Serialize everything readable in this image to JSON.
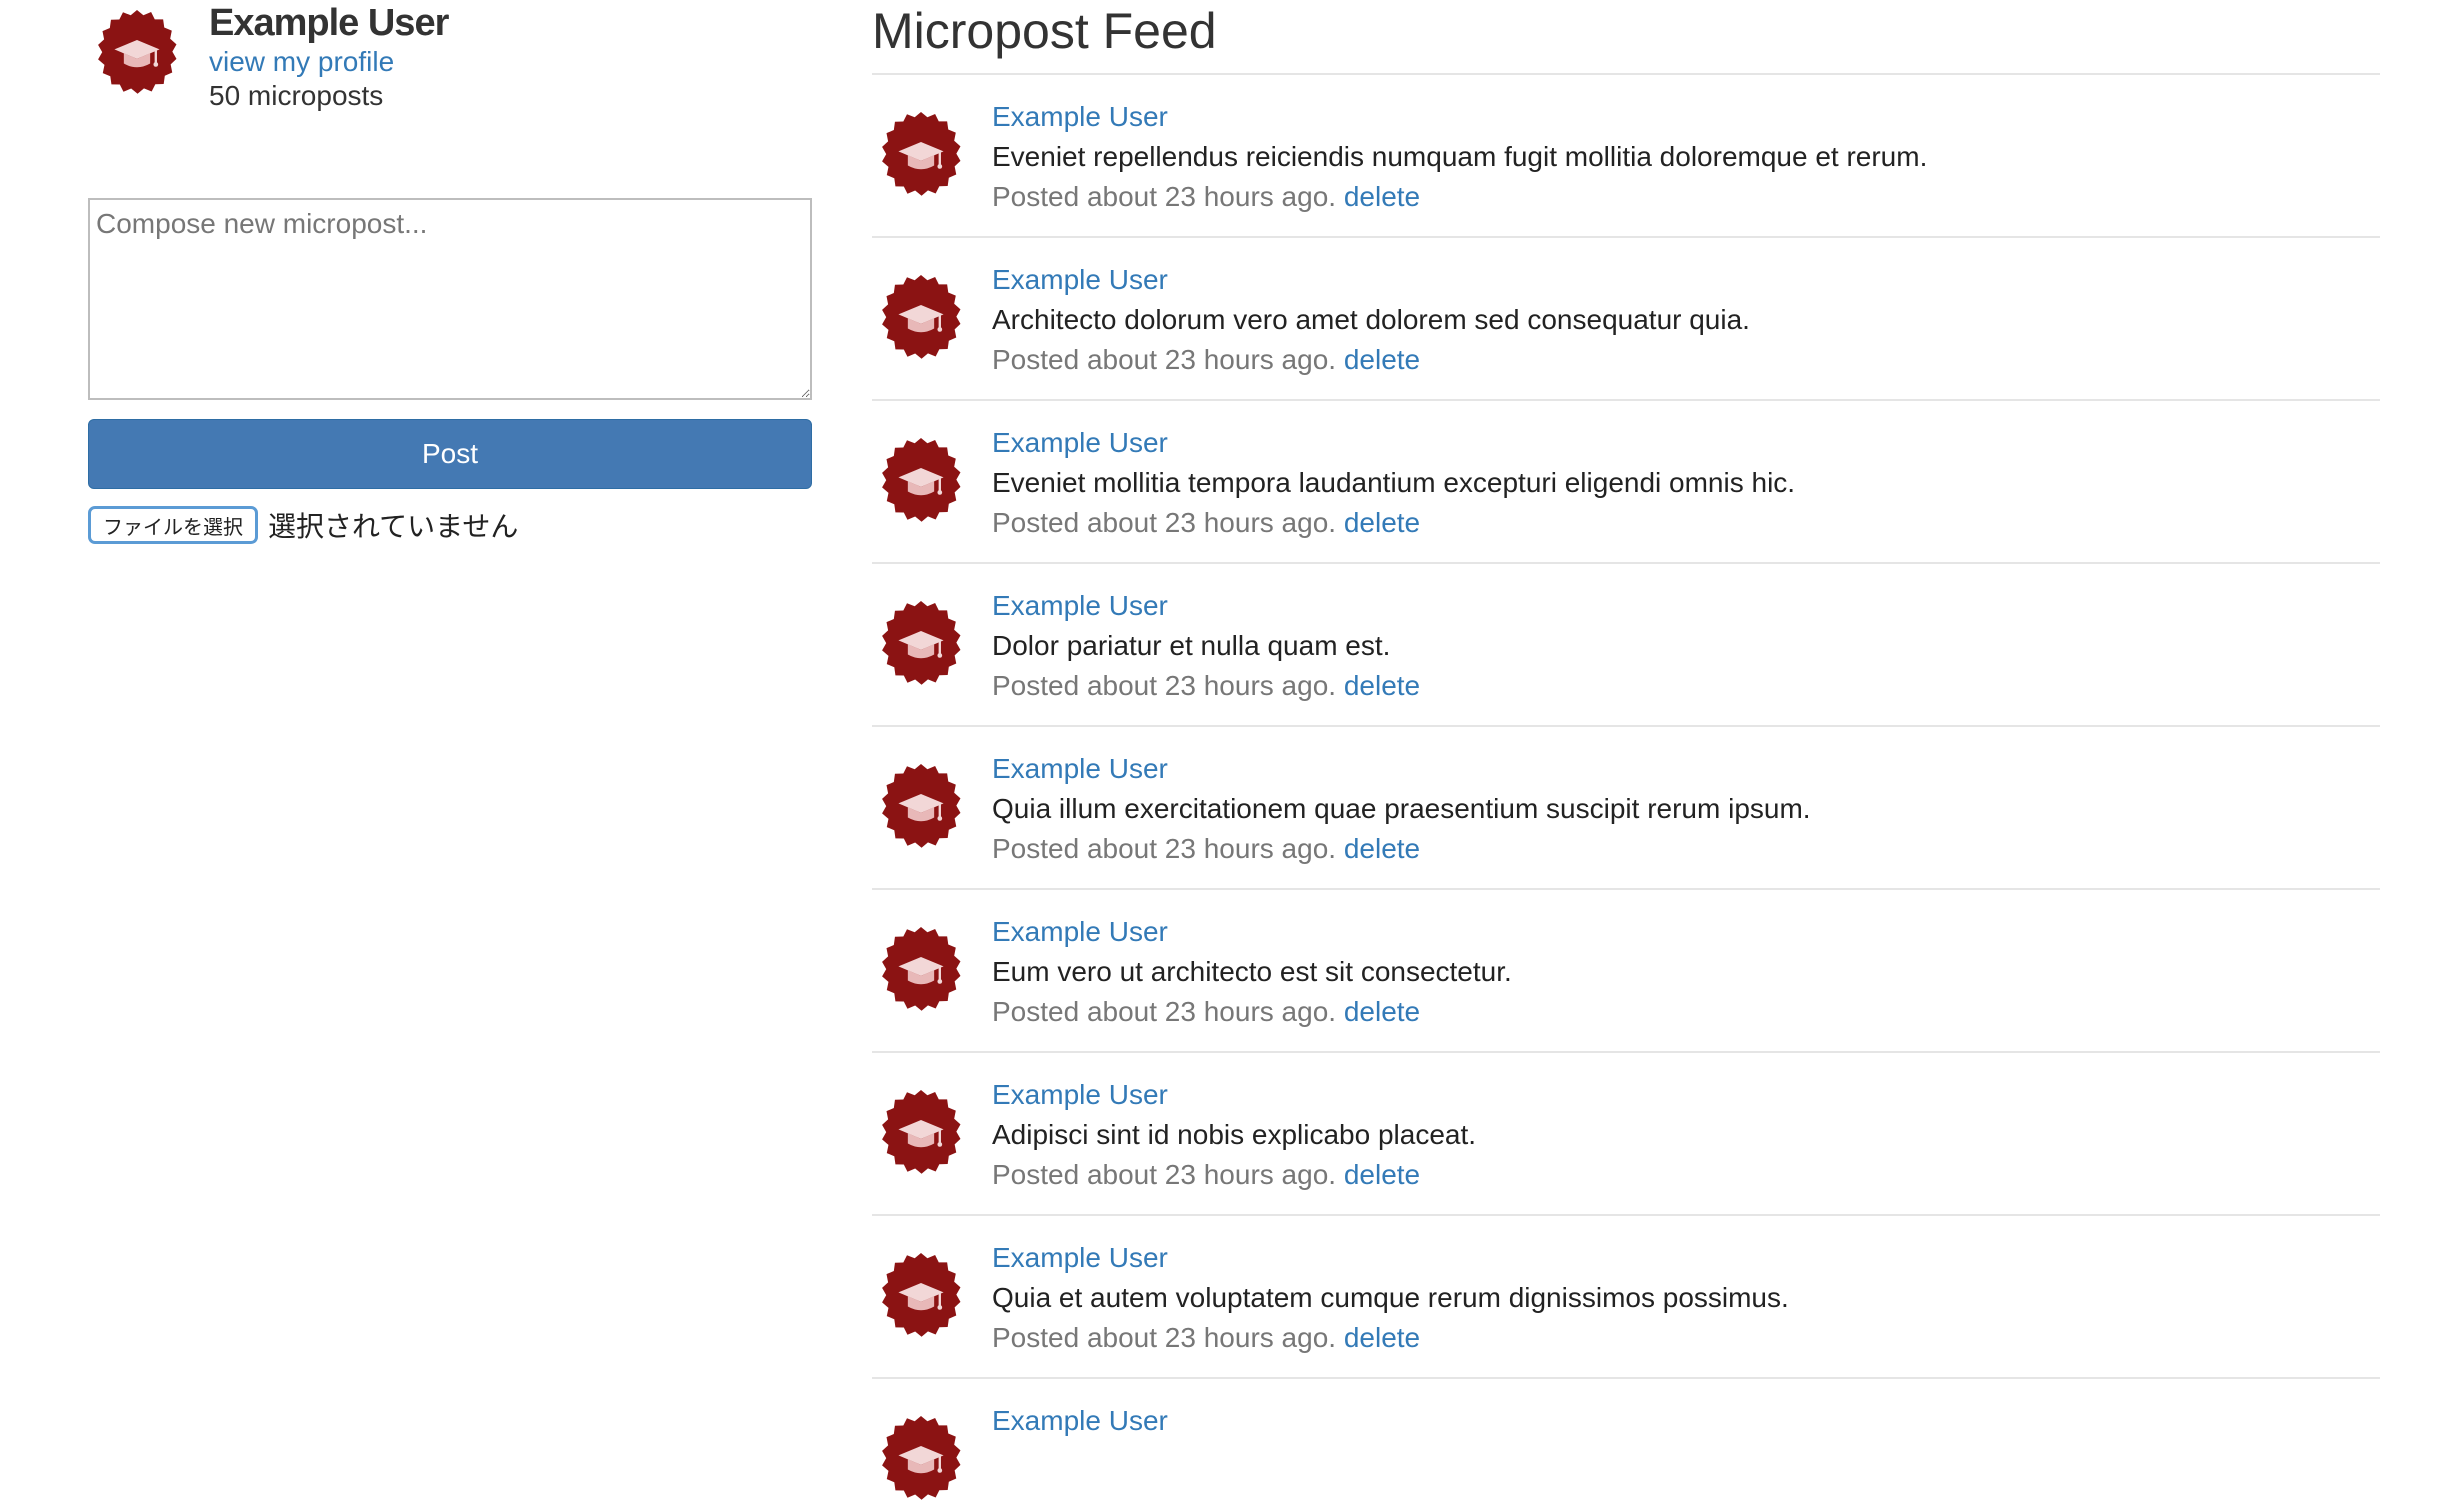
{
  "user": {
    "name": "Example User",
    "profile_link": "view my profile",
    "micropost_count": "50 microposts"
  },
  "compose": {
    "placeholder": "Compose new micropost...",
    "value": "",
    "post_label": "Post",
    "file_button": "ファイルを選択",
    "file_status": "選択されていません"
  },
  "feed": {
    "title": "Micropost Feed",
    "posts": [
      {
        "author": "Example User",
        "content": "Eveniet repellendus reiciendis numquam fugit mollitia doloremque et rerum.",
        "time": "Posted about 23 hours ago.",
        "delete": "delete"
      },
      {
        "author": "Example User",
        "content": "Architecto dolorum vero amet dolorem sed consequatur quia.",
        "time": "Posted about 23 hours ago.",
        "delete": "delete"
      },
      {
        "author": "Example User",
        "content": "Eveniet mollitia tempora laudantium excepturi eligendi omnis hic.",
        "time": "Posted about 23 hours ago.",
        "delete": "delete"
      },
      {
        "author": "Example User",
        "content": "Dolor pariatur et nulla quam est.",
        "time": "Posted about 23 hours ago.",
        "delete": "delete"
      },
      {
        "author": "Example User",
        "content": "Quia illum exercitationem quae praesentium suscipit rerum ipsum.",
        "time": "Posted about 23 hours ago.",
        "delete": "delete"
      },
      {
        "author": "Example User",
        "content": "Eum vero ut architecto est sit consectetur.",
        "time": "Posted about 23 hours ago.",
        "delete": "delete"
      },
      {
        "author": "Example User",
        "content": "Adipisci sint id nobis explicabo placeat.",
        "time": "Posted about 23 hours ago.",
        "delete": "delete"
      },
      {
        "author": "Example User",
        "content": "Quia et autem voluptatem cumque rerum dignissimos possimus.",
        "time": "Posted about 23 hours ago.",
        "delete": "delete"
      }
    ],
    "partial_author": "Example User"
  },
  "icons": {
    "avatar": "graduation-cap-badge-icon"
  },
  "colors": {
    "link": "#337ab7",
    "post_button": "#4479b3",
    "avatar_badge": "#8b1313",
    "muted_text": "#777777",
    "divider": "#e5e5e5"
  }
}
